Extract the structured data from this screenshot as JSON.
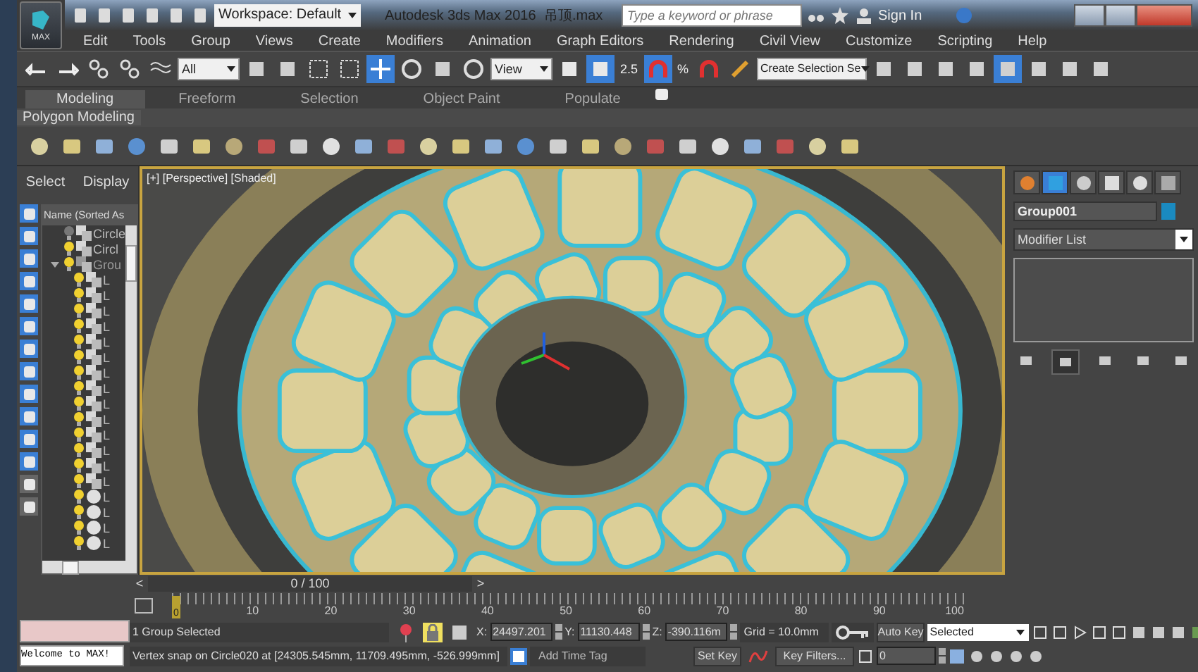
{
  "title_bar": {
    "logo": "MAX",
    "workspace": "Workspace: Default",
    "title": "Autodesk 3ds Max 2016",
    "file": "吊顶.max",
    "search_placeholder": "Type a keyword or phrase",
    "sign_in": "Sign In"
  },
  "menu": [
    "Edit",
    "Tools",
    "Group",
    "Views",
    "Create",
    "Modifiers",
    "Animation",
    "Graph Editors",
    "Rendering",
    "Civil View",
    "Customize",
    "Scripting",
    "Help"
  ],
  "main_toolbar": {
    "selection_filter": "All",
    "reference_coord": "View",
    "snap_3d": "2.5",
    "snap_percent": "%",
    "named_selection": "Create Selection Se"
  },
  "ribbon": {
    "tabs": [
      {
        "label": "Modeling",
        "selected": true
      },
      {
        "label": "Freeform",
        "selected": false
      },
      {
        "label": "Selection",
        "selected": false
      },
      {
        "label": "Object Paint",
        "selected": false
      },
      {
        "label": "Populate",
        "selected": false
      }
    ],
    "panel": "Polygon Modeling"
  },
  "scene_explorer": {
    "tabs": [
      "Select",
      "Display"
    ],
    "column": "Name (Sorted As",
    "items": [
      {
        "name": "Circle",
        "on": false,
        "kind": "shape"
      },
      {
        "name": "Circl",
        "on": true,
        "kind": "shape"
      },
      {
        "name": "Grou",
        "on": true,
        "kind": "group",
        "expanded": true,
        "children": [
          {
            "name": "L",
            "on": true,
            "kind": "shape"
          },
          {
            "name": "L",
            "on": true,
            "kind": "shape"
          },
          {
            "name": "L",
            "on": true,
            "kind": "shape"
          },
          {
            "name": "L",
            "on": true,
            "kind": "shape"
          },
          {
            "name": "L",
            "on": true,
            "kind": "shape"
          },
          {
            "name": "L",
            "on": true,
            "kind": "shape"
          },
          {
            "name": "L",
            "on": true,
            "kind": "shape"
          },
          {
            "name": "L",
            "on": true,
            "kind": "shape"
          },
          {
            "name": "L",
            "on": true,
            "kind": "shape"
          },
          {
            "name": "L",
            "on": true,
            "kind": "shape"
          },
          {
            "name": "L",
            "on": true,
            "kind": "shape"
          },
          {
            "name": "L",
            "on": true,
            "kind": "shape"
          },
          {
            "name": "L",
            "on": true,
            "kind": "shape"
          },
          {
            "name": "L",
            "on": true,
            "kind": "shape"
          },
          {
            "name": "L",
            "on": true,
            "kind": "geometry"
          },
          {
            "name": "L",
            "on": true,
            "kind": "geometry"
          },
          {
            "name": "L",
            "on": true,
            "kind": "geometry"
          },
          {
            "name": "L",
            "on": true,
            "kind": "geometry"
          }
        ]
      }
    ]
  },
  "viewport": {
    "label": "[+] [Perspective] [Shaded]"
  },
  "command_panel": {
    "tabs": [
      {
        "selected": false
      },
      {
        "selected": true
      },
      {
        "selected": false
      },
      {
        "selected": false
      },
      {
        "selected": false
      },
      {
        "selected": false
      }
    ],
    "object_name": "Group001",
    "modifier_list": "Modifier List"
  },
  "time_slider": {
    "previous": "<",
    "next": ">",
    "position": "0 / 100",
    "ticks": [
      "0",
      "10",
      "20",
      "30",
      "40",
      "50",
      "60",
      "70",
      "80",
      "90",
      "100"
    ]
  },
  "status_bar": {
    "listener_output": "Welcome to MAX!",
    "status": "1 Group Selected",
    "prompt": "Vertex snap on Circle020 at [24305.545mm, 11709.495mm, -526.999mm]",
    "selection_lock": true,
    "coords": [
      {
        "label": "X:",
        "value": "24497.201"
      },
      {
        "label": "Y:",
        "value": "11130.448"
      },
      {
        "label": "Z:",
        "value": "-390.116m"
      }
    ],
    "grid": "Grid = 10.0mm",
    "add_time_tag": "Add Time Tag",
    "auto_key": "Auto Key",
    "set_key": "Set Key",
    "key_mode": "Selected",
    "key_filters": "Key Filters...",
    "frame": "0"
  }
}
